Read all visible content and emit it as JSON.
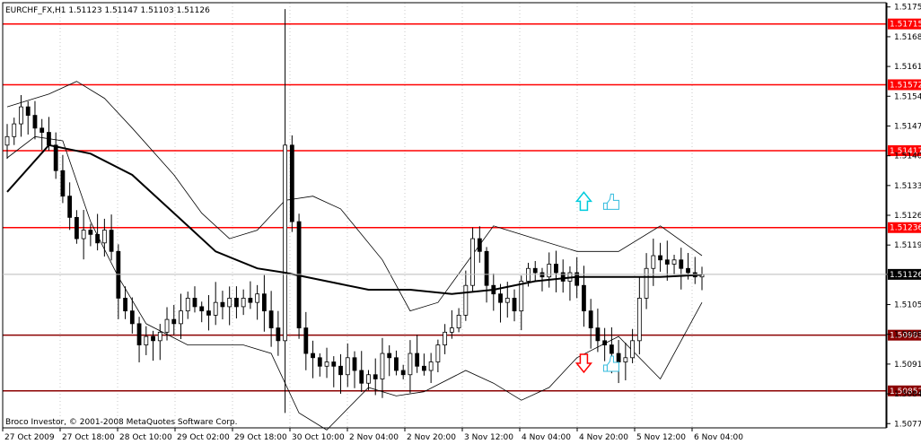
{
  "window": {
    "header": "EURCHF_FX,H1  1.51123 1.51147 1.51103 1.51126",
    "copyright": "Broco Investor, © 2001-2008 MetaQuotes Software Corp."
  },
  "colors": {
    "background": "#ffffff",
    "candle": "#000000",
    "moving_average": "#000000",
    "bands": "#000000",
    "level_bright": "#ff0000",
    "level_dark": "#8b0000",
    "up_arrow": "#00ccdd",
    "down_arrow": "#ff0000",
    "thumb_icon": "#33bbdd"
  },
  "icons": {
    "up_arrow": "up-arrow-icon",
    "down_arrow": "down-arrow-icon",
    "thumbs_up": "thumbs-up-icon"
  },
  "chart_data": {
    "type": "candlestick",
    "symbol": "EURCHF_FX",
    "timeframe": "H1",
    "ohlc_last": {
      "open": 1.51123,
      "high": 1.51147,
      "low": 1.51103,
      "close": 1.51126
    },
    "current_price": "1.51126",
    "ylim": [
      1.50765,
      1.51765
    ],
    "y_ticks": [
      "1.51755",
      "1.51685",
      "1.51615",
      "1.51545",
      "1.51475",
      "1.51405",
      "1.51335",
      "1.51265",
      "1.51195",
      "1.51126",
      "1.51055",
      "1.50985",
      "1.50915",
      "1.50845",
      "1.50775"
    ],
    "x_ticks": [
      "27 Oct 2009",
      "27 Oct 18:00",
      "28 Oct 10:00",
      "29 Oct 02:00",
      "29 Oct 18:00",
      "30 Oct 10:00",
      "2 Nov 04:00",
      "2 Nov 20:00",
      "3 Nov 12:00",
      "4 Nov 04:00",
      "4 Nov 20:00",
      "5 Nov 12:00",
      "6 Nov 04:00"
    ],
    "levels": [
      {
        "price": 1.51715,
        "label": "1.51715",
        "style": "bright"
      },
      {
        "price": 1.51572,
        "label": "1.51572",
        "style": "bright"
      },
      {
        "price": 1.51417,
        "label": "1.51417",
        "style": "bright"
      },
      {
        "price": 1.51236,
        "label": "1.51236",
        "style": "bright"
      },
      {
        "price": 1.50983,
        "label": "1.50983",
        "style": "dark"
      },
      {
        "price": 1.50852,
        "label": "1.50852",
        "style": "dark"
      }
    ],
    "trend_closes": [
      1.5145,
      1.5148,
      1.5152,
      1.515,
      1.5147,
      1.5146,
      1.5143,
      1.5137,
      1.5131,
      1.5126,
      1.5121,
      1.5123,
      1.5122,
      1.512,
      1.5123,
      1.5118,
      1.5107,
      1.5104,
      1.5101,
      1.5096,
      1.5098,
      1.5097,
      1.5099,
      1.5102,
      1.5101,
      1.5104,
      1.5107,
      1.5105,
      1.5104,
      1.5103,
      1.5106,
      1.5105,
      1.5107,
      1.5105,
      1.5107,
      1.5106,
      1.5108,
      1.5104,
      1.51,
      1.5097,
      1.5143,
      1.5125,
      1.51,
      1.5094,
      1.5093,
      1.5091,
      1.5092,
      1.5091,
      1.5089,
      1.5093,
      1.509,
      1.5087,
      1.5089,
      1.5088,
      1.5094,
      1.5093,
      1.509,
      1.5089,
      1.5094,
      1.5091,
      1.509,
      1.5092,
      1.5096,
      1.5099,
      1.51,
      1.5103,
      1.511,
      1.5121,
      1.5118,
      1.511,
      1.5108,
      1.5106,
      1.5107,
      1.5104,
      1.5111,
      1.5114,
      1.5113,
      1.5112,
      1.5115,
      1.5113,
      1.5111,
      1.5113,
      1.511,
      1.5104,
      1.51,
      1.5097,
      1.5096,
      1.5094,
      1.5092,
      1.5093,
      1.5097,
      1.5107,
      1.5114,
      1.5117,
      1.5116,
      1.5115,
      1.5116,
      1.5114,
      1.5113,
      1.5112,
      1.51126
    ],
    "ma_points": [
      [
        0,
        1.5132
      ],
      [
        6,
        1.5143
      ],
      [
        12,
        1.5141
      ],
      [
        18,
        1.5136
      ],
      [
        24,
        1.5127
      ],
      [
        30,
        1.5118
      ],
      [
        36,
        1.5114
      ],
      [
        40,
        1.5113
      ],
      [
        46,
        1.5111
      ],
      [
        52,
        1.5109
      ],
      [
        58,
        1.5109
      ],
      [
        64,
        1.5108
      ],
      [
        70,
        1.5109
      ],
      [
        76,
        1.5111
      ],
      [
        82,
        1.5112
      ],
      [
        88,
        1.5112
      ],
      [
        94,
        1.5112
      ],
      [
        100,
        1.51125
      ]
    ],
    "upper_band_points": [
      [
        0,
        1.5152
      ],
      [
        6,
        1.5155
      ],
      [
        10,
        1.5158
      ],
      [
        14,
        1.5154
      ],
      [
        18,
        1.5147
      ],
      [
        24,
        1.5136
      ],
      [
        28,
        1.5127
      ],
      [
        32,
        1.5121
      ],
      [
        36,
        1.5123
      ],
      [
        40,
        1.513
      ],
      [
        44,
        1.5131
      ],
      [
        48,
        1.5128
      ],
      [
        54,
        1.5116
      ],
      [
        58,
        1.5104
      ],
      [
        62,
        1.5106
      ],
      [
        66,
        1.5115
      ],
      [
        70,
        1.5124
      ],
      [
        76,
        1.5121
      ],
      [
        82,
        1.5118
      ],
      [
        88,
        1.5118
      ],
      [
        94,
        1.5124
      ],
      [
        100,
        1.5117
      ]
    ],
    "lower_band_points": [
      [
        0,
        1.514
      ],
      [
        4,
        1.5145
      ],
      [
        8,
        1.5144
      ],
      [
        12,
        1.5125
      ],
      [
        16,
        1.5112
      ],
      [
        20,
        1.5101
      ],
      [
        26,
        1.5096
      ],
      [
        30,
        1.5096
      ],
      [
        34,
        1.5096
      ],
      [
        38,
        1.5094
      ],
      [
        42,
        1.508
      ],
      [
        46,
        1.5076
      ],
      [
        52,
        1.5086
      ],
      [
        56,
        1.5084
      ],
      [
        60,
        1.5085
      ],
      [
        66,
        1.509
      ],
      [
        70,
        1.5087
      ],
      [
        74,
        1.5083
      ],
      [
        78,
        1.5086
      ],
      [
        82,
        1.5093
      ],
      [
        88,
        1.5098
      ],
      [
        94,
        1.5088
      ],
      [
        100,
        1.5106
      ]
    ],
    "markers": [
      {
        "type": "up-arrow",
        "x_index": 83,
        "price": 1.51298
      },
      {
        "type": "down-arrow",
        "x_index": 83,
        "price": 1.50917
      }
    ]
  }
}
